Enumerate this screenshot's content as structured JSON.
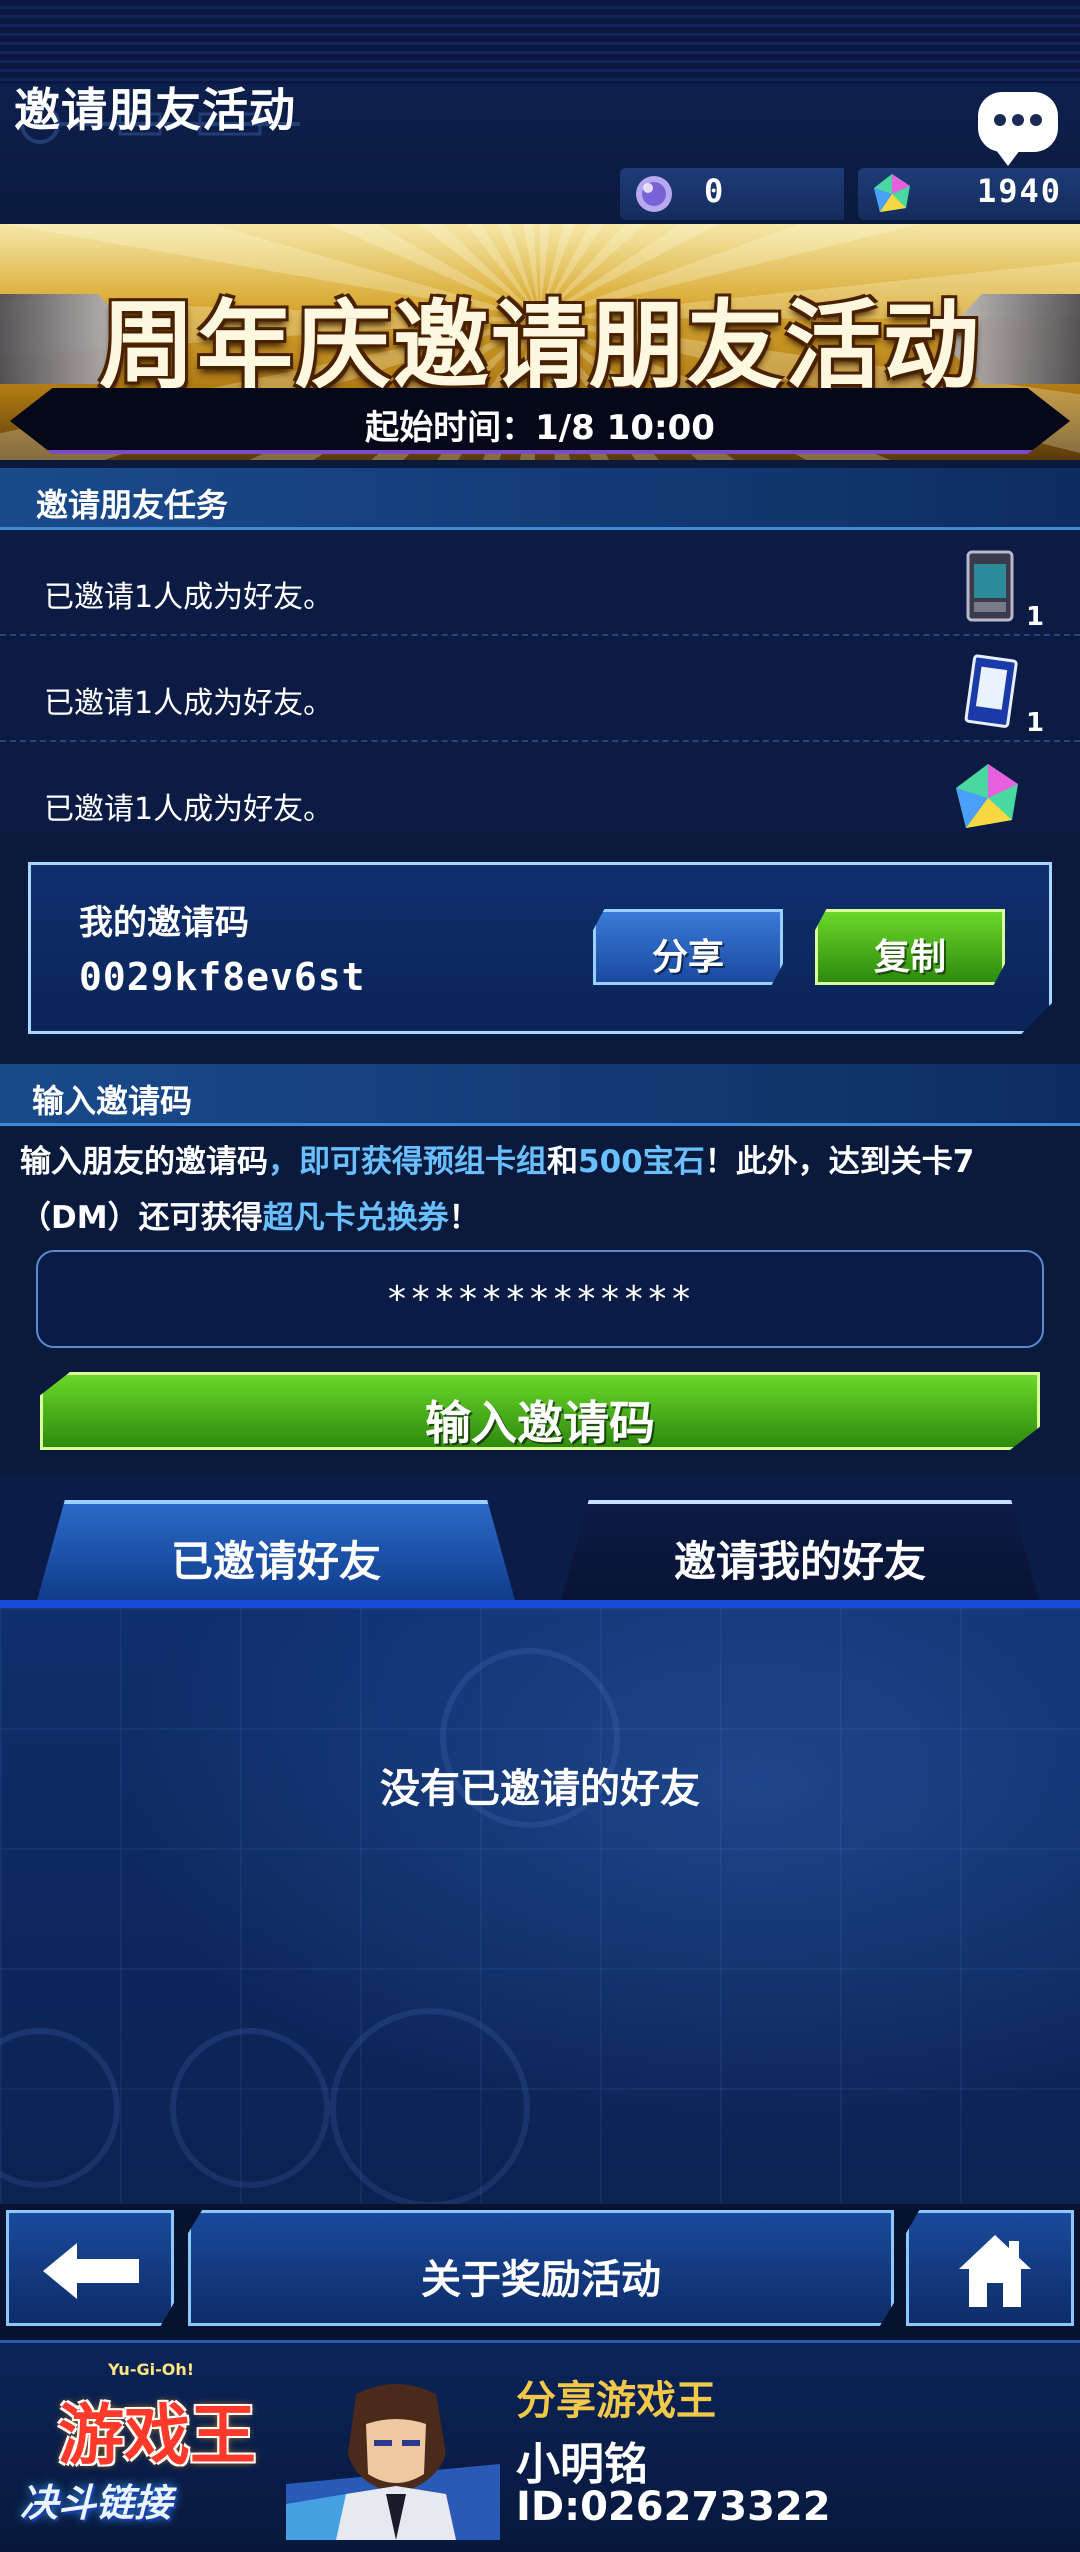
{
  "header": {
    "title": "邀请朋友活动",
    "orbs": "0",
    "gems": "1940"
  },
  "banner": {
    "title": "周年庆邀请朋友活动",
    "start_time": "起始时间：1/8 10:00"
  },
  "tasks": {
    "heading": "邀请朋友任务",
    "items": [
      {
        "text": "已邀请1人成为好友。",
        "qty": "1",
        "reward_icon": "card-pack-icon"
      },
      {
        "text": "已邀请1人成为好友。",
        "qty": "1",
        "reward_icon": "card-icon"
      },
      {
        "text": "已邀请1人成为好友。",
        "qty": "",
        "reward_icon": "gem-icon"
      }
    ]
  },
  "my_code": {
    "label": "我的邀请码",
    "code": "0029kf8ev6st",
    "share_label": "分享",
    "copy_label": "复制"
  },
  "enter_code": {
    "heading": "输入邀请码",
    "desc_1": "输入朋友的邀请码",
    "desc_2": "，即可获得预组卡组",
    "desc_3": "和",
    "desc_4": "500宝石",
    "desc_5": "！此外，达到关卡7（DM）还可获得",
    "desc_6": "超凡卡兑换券",
    "desc_7": "！",
    "input_value": "*************",
    "button_label": "输入邀请码"
  },
  "tabs": {
    "invited": "已邀请好友",
    "invited_me": "邀请我的好友"
  },
  "list": {
    "empty_message": "没有已邀请的好友"
  },
  "bottom": {
    "reward_label": "关于奖励活动"
  },
  "footer": {
    "logo_small": "Yu-Gi-Oh!",
    "logo_main": "游戏王",
    "logo_sub": "决斗链接",
    "share_title": "分享游戏王",
    "player_name": "小明铭",
    "player_id": "ID:026273322"
  },
  "colors": {
    "highlight": "#6ac0ff",
    "green_button": "#4cb81c",
    "blue_button": "#2a64c0",
    "gold": "#f2c84a"
  }
}
